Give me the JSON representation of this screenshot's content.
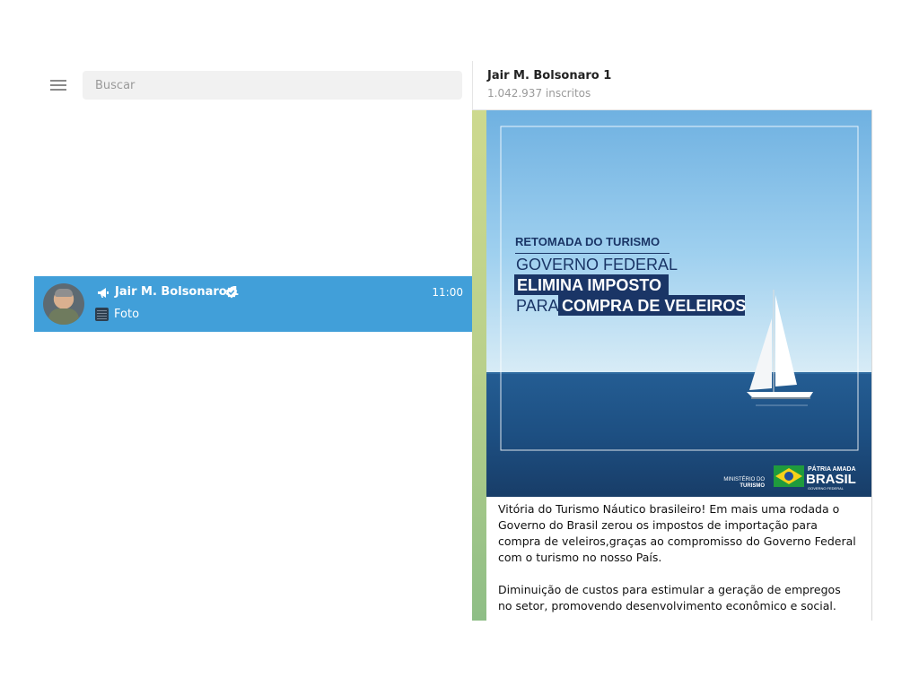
{
  "search": {
    "placeholder": "Buscar"
  },
  "chat_list": {
    "items": [
      {
        "name": "Jair M. Bolsonaro 1",
        "time": "11:00",
        "preview": "Foto"
      }
    ]
  },
  "channel": {
    "title": "Jair M. Bolsonaro 1",
    "subscribers": "1.042.937 inscritos"
  },
  "message": {
    "image": {
      "line1": "RETOMADA DO TURISMO",
      "line2": "GOVERNO FEDERAL",
      "line3": "ELIMINA IMPOSTO",
      "line4a": "PARA",
      "line4b": "COMPRA DE VELEIROS",
      "ministry_line1": "MINISTÉRIO DO",
      "ministry_line2": "TURISMO",
      "logo_line1": "PÁTRIA AMADA",
      "logo_line2": "BRASIL",
      "logo_line3": "GOVERNO FEDERAL"
    },
    "paragraph1": "Vitória do Turismo Náutico brasileiro! Em mais uma rodada o Governo do Brasil zerou os impostos de importação para compra de veleiros,graças ao compromisso do Governo Federal com o turismo no nosso País.",
    "paragraph2": "Diminuição de custos para estimular a geração de empregos no setor, promovendo desenvolvimento econômico e social."
  },
  "colors": {
    "selected_chat": "#419fd9",
    "sky": "#8cc6ea",
    "sea": "#1f4f84"
  },
  "icons": [
    "menu-icon",
    "megaphone-icon",
    "verified-icon",
    "photo-icon",
    "sailboat-icon",
    "brazil-flag-icon"
  ]
}
